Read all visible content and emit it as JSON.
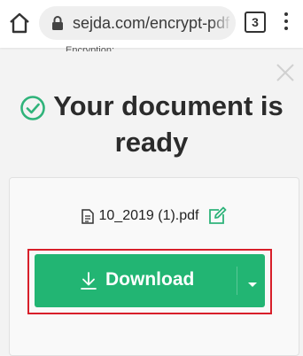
{
  "browser": {
    "url": "sejda.com/encrypt-pdf",
    "tab_count": "3",
    "icons": {
      "home": "home-icon",
      "lock": "lock-icon",
      "menu": "more-vertical-icon"
    }
  },
  "page": {
    "clipped_label": "Encryption:",
    "title": "Your document is ready",
    "file_name": "10_2019 (1).pdf",
    "download_label": "Download",
    "icons": {
      "close": "close-icon",
      "success": "check-circle-icon",
      "file": "file-icon",
      "edit": "edit-icon",
      "download": "download-icon",
      "dropdown": "chevron-down-icon"
    }
  },
  "colors": {
    "accent": "#22b573",
    "highlight_border": "#d81f2a",
    "check": "#2fb37a"
  }
}
